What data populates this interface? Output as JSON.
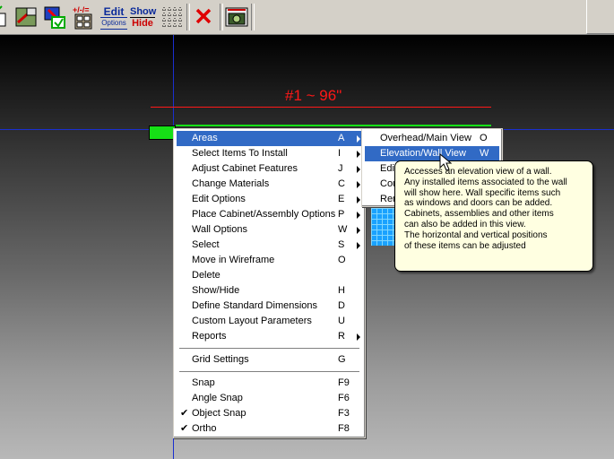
{
  "toolbar": {
    "items": [
      {
        "name": "doc-check-icon"
      },
      {
        "name": "map-icon"
      },
      {
        "name": "move-install-icon"
      },
      {
        "name": "plus-minus-equals-icon",
        "label": "+/-/="
      },
      {
        "name": "edit-options-icon",
        "label_top": "Edit",
        "label_bottom": "Options"
      },
      {
        "name": "show-hide-icon",
        "label_top": "Show",
        "label_bottom": "Hide"
      },
      {
        "name": "grid-icon"
      },
      {
        "name": "delete-x-icon"
      },
      {
        "name": "camera-icon"
      }
    ]
  },
  "canvas": {
    "dimension_label": "#1 ~ 96\"",
    "colors": {
      "dimension": "#ff1818",
      "guide": "#1a2fd0",
      "wall": "#16e016"
    }
  },
  "context_menu": {
    "items": [
      {
        "label": "Areas",
        "key": "A",
        "submenu": true,
        "highlighted": true
      },
      {
        "label": "Select Items To Install",
        "key": "I",
        "submenu": true
      },
      {
        "label": "Adjust Cabinet Features",
        "key": "J",
        "submenu": true
      },
      {
        "label": "Change Materials",
        "key": "C",
        "submenu": true
      },
      {
        "label": "Edit Options",
        "key": "E",
        "submenu": true
      },
      {
        "label": "Place Cabinet/Assembly Options",
        "key": "P",
        "submenu": true
      },
      {
        "label": "Wall Options",
        "key": "W",
        "submenu": true
      },
      {
        "label": "Select",
        "key": "S",
        "submenu": true
      },
      {
        "label": "Move in Wireframe",
        "key": "O"
      },
      {
        "label": "Delete",
        "key": ""
      },
      {
        "label": "Show/Hide",
        "key": "H"
      },
      {
        "label": "Define Standard Dimensions",
        "key": "D"
      },
      {
        "label": "Custom Layout Parameters",
        "key": "U"
      },
      {
        "label": "Reports",
        "key": "R",
        "submenu": true
      },
      {
        "separator": true
      },
      {
        "label": "Grid Settings",
        "key": "G"
      },
      {
        "separator": true
      },
      {
        "label": "Snap",
        "key": "F9"
      },
      {
        "label": "Angle Snap",
        "key": "F6"
      },
      {
        "label": "Object Snap",
        "key": "F3",
        "checked": true
      },
      {
        "label": "Ortho",
        "key": "F8",
        "checked": true
      }
    ]
  },
  "submenu": {
    "items": [
      {
        "label": "Overhead/Main View",
        "key": "O"
      },
      {
        "label": "Elevation/Wall View",
        "key": "W",
        "highlighted": true
      },
      {
        "label": "Edit",
        "key": ""
      },
      {
        "label": "Cou",
        "key": ""
      },
      {
        "label": "Ren",
        "key": ""
      }
    ]
  },
  "tooltip": {
    "lines": [
      "Accesses an elevation view of a wall.",
      "Any installed items associated to the wall",
      "will show here. Wall specific items such",
      "as windows and doors can be added.",
      "Cabinets, assemblies and other items",
      "can also be added in this view.",
      "The horizontal and vertical positions",
      "of these items can be adjusted"
    ]
  }
}
